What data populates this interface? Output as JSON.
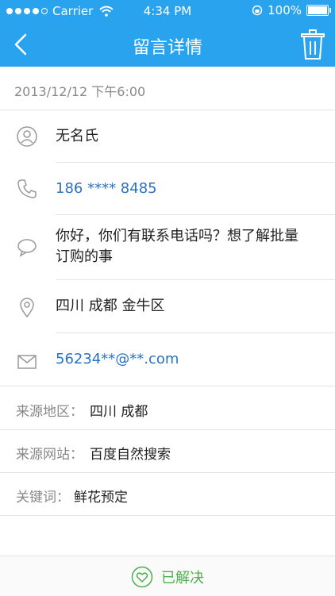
{
  "status_bar": {
    "carrier": "Carrier",
    "time": "4:34 PM",
    "battery": "100%"
  },
  "nav": {
    "title": "留言详情"
  },
  "message": {
    "date": "2013/12/12  下午6:00",
    "name": "无名氏",
    "phone": "186  ****  8485",
    "content": "你好，你们有联系电话吗？想了解批量订购的事",
    "location": "四川 成都 金牛区",
    "email": "56234**@**.com"
  },
  "meta": [
    {
      "label": "来源地区：",
      "value": "四川  成都"
    },
    {
      "label": "来源网站：",
      "value": "百度自然搜索"
    },
    {
      "label": "关键词：",
      "value": "鲜花预定"
    }
  ],
  "footer": {
    "resolved_label": "已解决"
  },
  "colors": {
    "accent": "#2aa3ee",
    "link": "#2a72c4",
    "resolved": "#4cb04c"
  }
}
